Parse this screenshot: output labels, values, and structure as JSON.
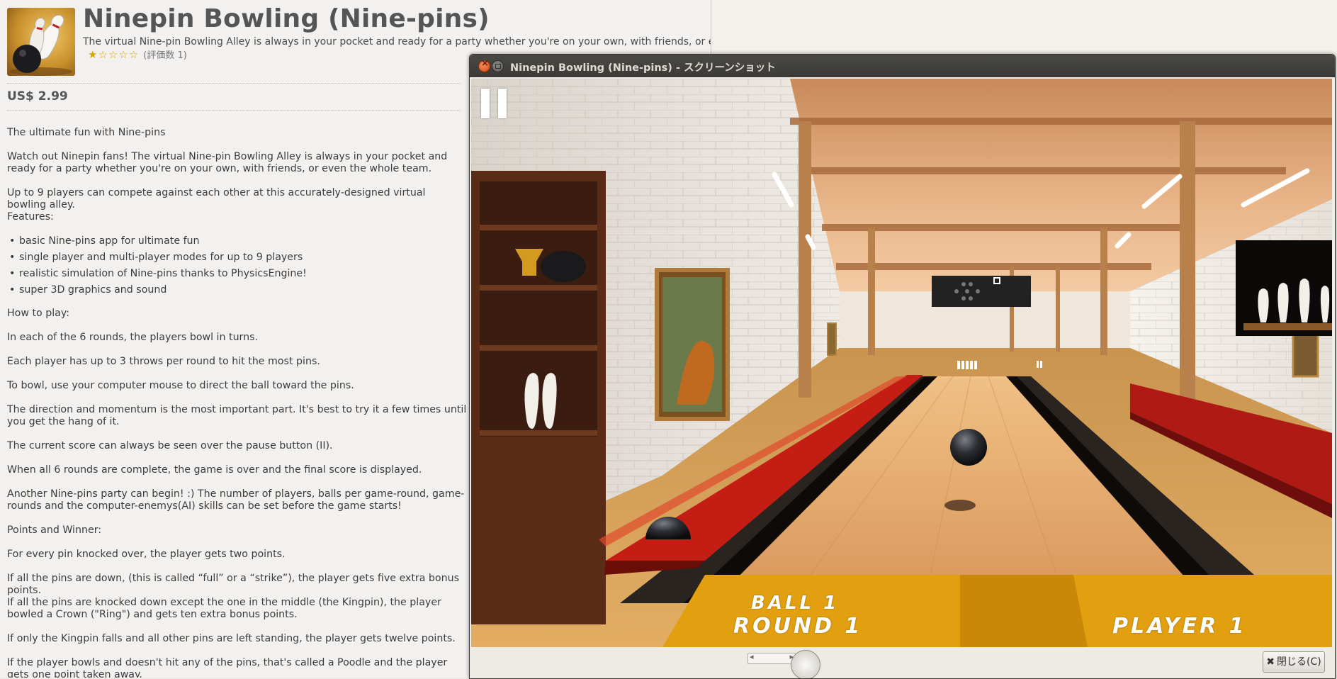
{
  "app": {
    "title": "Ninepin Bowling (Nine-pins)",
    "tagline": "The virtual Nine-pin Bowling Alley is always in your pocket and ready for a party whether you're on your own, with friends, or e",
    "stars": "★☆☆☆☆",
    "rating_count": "(評価数 1)",
    "price": "US$ 2.99"
  },
  "description": {
    "p1": "The ultimate fun with Nine-pins",
    "p2": "Watch out Ninepin fans! The virtual Nine-pin Bowling Alley is always in your pocket and ready for a party whether you're on your own, with friends, or even the whole team.",
    "p3": "Up to 9 players can compete against each other at this accurately-designed virtual bowling alley.",
    "features_heading": "Features:",
    "features": [
      "basic Nine-pins app for ultimate fun",
      "single player and multi-player modes for up to 9 players",
      "realistic simulation of Nine-pins thanks to PhysicsEngine!",
      "super 3D graphics and sound"
    ],
    "howto_heading": "How to play:",
    "p4": "In each of the 6 rounds, the players bowl in turns.",
    "p5": "Each player has up to 3 throws per round to hit the most pins.",
    "p6": "To bowl, use your computer mouse to direct the ball toward the pins.",
    "p7": "The direction and momentum is the most important part. It's best to try it a few times until you get the hang of it.",
    "p8": "The current score can always be seen over the pause button (II).",
    "p9": "When all 6 rounds are complete, the game is over and the final score is displayed.",
    "p10": "Another Nine-pins party can begin! :) The number of players, balls per game-round, game-rounds and the computer-enemys(AI) skills can be set before the game starts!",
    "points_heading": "Points and Winner:",
    "p11": "For every pin knocked over, the player gets two points.",
    "p12": "If all the pins are down, (this is called “full” or a “strike”), the player gets five extra bonus points.",
    "p13": "If all the pins are knocked down except the one in the middle (the Kingpin), the player bowled a Crown (\"Ring\") and gets ten extra bonus points.",
    "p14": "If only the Kingpin falls and all other pins are left standing, the player gets twelve points.",
    "p15": "If the player bowls and doesn't hit any of the pins, that's called a Poodle and the player gets one point taken away."
  },
  "viewer": {
    "title": "Ninepin Bowling (Nine-pins) - スクリーンショット",
    "close_label": "閉じる(C)",
    "close_icon": "close-x-icon",
    "scroll_left": "◂",
    "scroll_right": "▸"
  },
  "game": {
    "ball": "BALL 1",
    "round": "ROUND 1",
    "player": "PLAYER 1"
  },
  "colors": {
    "store_bg": "#f3f1ef",
    "titlebar": "#3c3b37",
    "close_orange": "#e05a20",
    "lane_wood": "#d99a55",
    "gutter_red": "#b01a14",
    "hud_amber": "#f0a010"
  }
}
